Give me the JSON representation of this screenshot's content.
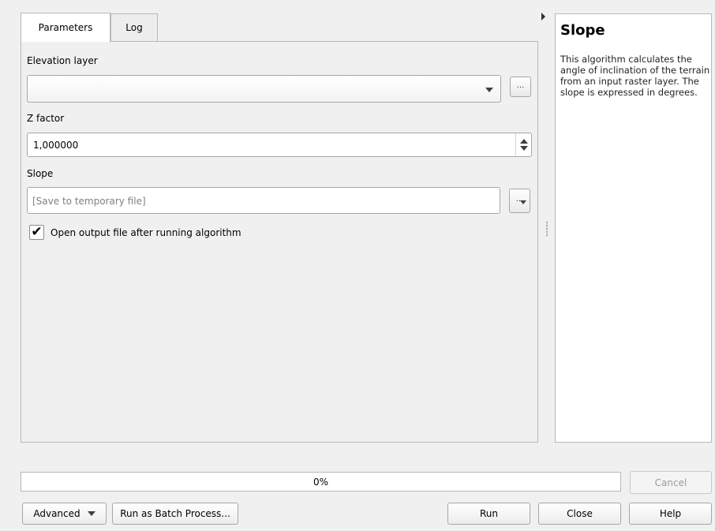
{
  "tabs": [
    {
      "label": "Parameters"
    },
    {
      "label": "Log"
    }
  ],
  "params": {
    "elevation_label": "Elevation layer",
    "elevation_value": "",
    "browse_label": "...",
    "zfactor_label": "Z factor",
    "zfactor_value": "1,000000",
    "slope_label": "Slope",
    "slope_placeholder": "[Save to temporary file]",
    "slope_browse_label": "...",
    "open_output_label": "Open output file after running algorithm",
    "open_output_checked": true,
    "check_mark": "✔"
  },
  "help": {
    "title": "Slope",
    "text": "This algorithm calculates the angle of inclination of the terrain from an input raster layer. The slope is expressed in degrees."
  },
  "progress": {
    "value": 0,
    "text": "0%"
  },
  "buttons": {
    "cancel": "Cancel",
    "advanced": "Advanced",
    "batch": "Run as Batch Process...",
    "run": "Run",
    "close": "Close",
    "help": "Help"
  }
}
